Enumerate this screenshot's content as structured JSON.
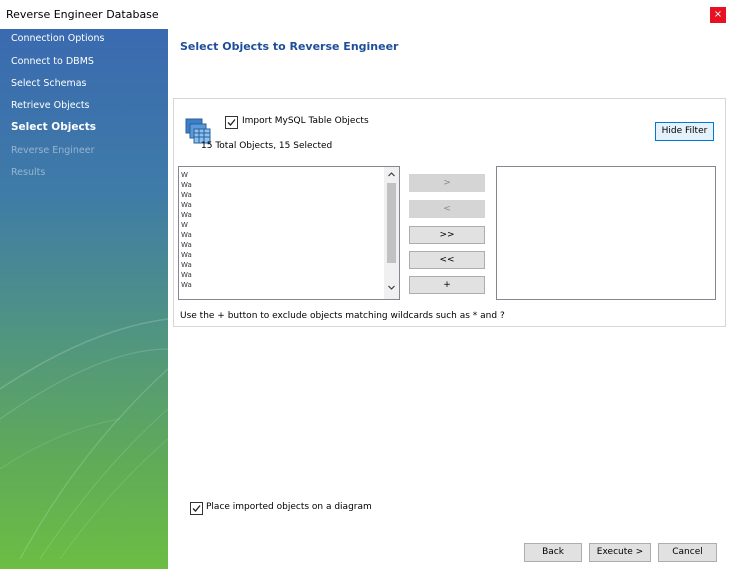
{
  "window": {
    "title": "Reverse Engineer Database",
    "close_glyph": "×"
  },
  "sidebar": {
    "items": [
      {
        "label": "Connection Options",
        "state": "done"
      },
      {
        "label": "Connect to DBMS",
        "state": "done"
      },
      {
        "label": "Select Schemas",
        "state": "done"
      },
      {
        "label": "Retrieve Objects",
        "state": "done"
      },
      {
        "label": "Select Objects",
        "state": "active"
      },
      {
        "label": "Reverse Engineer",
        "state": "pending"
      },
      {
        "label": "Results",
        "state": "pending"
      }
    ]
  },
  "main": {
    "title": "Select Objects to Reverse Engineer",
    "import": {
      "icon": "database-tables-icon",
      "checkbox_label": "Import MySQL Table Objects",
      "checked": true,
      "summary": "15 Total Objects, 15 Selected"
    },
    "hide_filter_label": "Hide Filter",
    "left_list": {
      "items": [
        "W",
        "Wa",
        "Wa",
        "Wa",
        "Wa",
        "W",
        "Wa",
        "Wa",
        "Wa",
        "Wa",
        "Wa",
        "Wa"
      ]
    },
    "move_buttons": [
      {
        "label": ">",
        "enabled": false
      },
      {
        "label": "<",
        "enabled": false
      },
      {
        "label": ">>",
        "enabled": true
      },
      {
        "label": "<<",
        "enabled": true
      },
      {
        "label": "+",
        "enabled": true
      }
    ],
    "hint": "Use the + button to exclude objects matching wildcards such as * and ?"
  },
  "footer": {
    "place_on_diagram_label": "Place imported objects on a diagram",
    "place_on_diagram_checked": true,
    "back_label": "Back",
    "execute_label": "Execute >",
    "cancel_label": "Cancel"
  },
  "colors": {
    "accent": "#0078d7",
    "title_blue": "#1e4e9a",
    "close_red": "#e81123"
  }
}
